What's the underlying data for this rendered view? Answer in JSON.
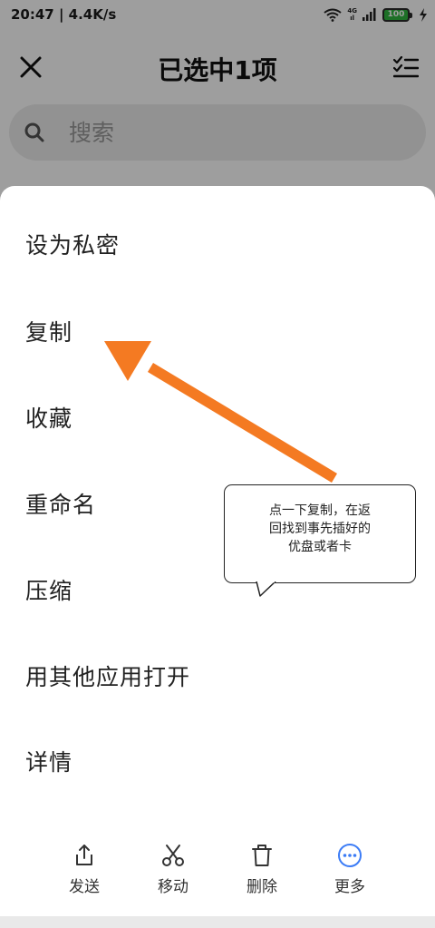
{
  "status_bar": {
    "time_speed": "20:47 | 4.4K/s",
    "network_top": "4G",
    "network_bottom": "ıl",
    "battery": "100",
    "icons": [
      "wifi-icon",
      "signal-icon",
      "battery-icon",
      "charging-icon"
    ]
  },
  "header": {
    "title": "已选中1项",
    "close_icon": "close-icon",
    "select_all_icon": "checklist-icon"
  },
  "search": {
    "placeholder": "搜索",
    "icon": "search-icon"
  },
  "menu": {
    "items": [
      {
        "label": "设为私密"
      },
      {
        "label": "复制"
      },
      {
        "label": "收藏"
      },
      {
        "label": "重命名"
      },
      {
        "label": "压缩"
      },
      {
        "label": "用其他应用打开"
      },
      {
        "label": "详情"
      }
    ]
  },
  "actions": [
    {
      "label": "发送",
      "icon": "share-icon"
    },
    {
      "label": "移动",
      "icon": "scissors-icon"
    },
    {
      "label": "删除",
      "icon": "trash-icon"
    },
    {
      "label": "更多",
      "icon": "more-icon"
    }
  ],
  "annotation": {
    "text": "点一下复制，在返\n回找到事先插好的\n优盘或者卡",
    "arrow_color": "#f47a22",
    "active_color": "#3c7cf6"
  }
}
